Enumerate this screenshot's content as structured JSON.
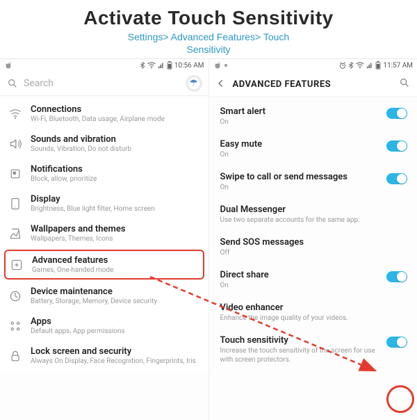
{
  "title": "Activate Touch Sensitivity",
  "breadcrumb_line1": "Settings> Advanced Features> Touch",
  "breadcrumb_line2": "Sensitivity",
  "left": {
    "status_time": "10:56 AM",
    "search_placeholder": "Search",
    "items": [
      {
        "icon": "connections",
        "label": "Connections",
        "sub": "Wi-Fi, Bluetooth, Data usage, Airplane mode"
      },
      {
        "icon": "sound",
        "label": "Sounds and vibration",
        "sub": "Sounds, Vibration, Do not disturb"
      },
      {
        "icon": "notifications",
        "label": "Notifications",
        "sub": "Block, allow, prioritize"
      },
      {
        "icon": "display",
        "label": "Display",
        "sub": "Brightness, Blue light filter, Home screen"
      },
      {
        "icon": "wallpapers",
        "label": "Wallpapers and themes",
        "sub": "Wallpapers, Themes, Icons"
      },
      {
        "icon": "advanced",
        "label": "Advanced features",
        "sub": "Games, One-handed mode",
        "highlight": true
      },
      {
        "icon": "maintenance",
        "label": "Device maintenance",
        "sub": "Battery, Storage, Memory, Device security"
      },
      {
        "icon": "apps",
        "label": "Apps",
        "sub": "Default apps, App permissions"
      },
      {
        "icon": "lock",
        "label": "Lock screen and security",
        "sub": "Always On Display, Face Recognition, Fingerprints, Iris"
      }
    ]
  },
  "right": {
    "status_time": "11:57 AM",
    "title": "ADVANCED FEATURES",
    "items": [
      {
        "label": "Smart alert",
        "sub": "On",
        "toggle": "on"
      },
      {
        "label": "Easy mute",
        "sub": "On",
        "toggle": "on"
      },
      {
        "label": "Swipe to call or send messages",
        "sub": "On",
        "toggle": "on"
      },
      {
        "label": "Dual Messenger",
        "sub": "Use two separate accounts for the same app."
      },
      {
        "label": "Send SOS messages",
        "sub": "Off"
      },
      {
        "label": "Direct share",
        "sub": "On",
        "toggle": "on"
      },
      {
        "label": "Video enhancer",
        "sub": "Enhance the image quality of your videos."
      },
      {
        "label": "Touch sensitivity",
        "sub": "Increase the touch sensitivity of the screen for use with screen protectors.",
        "toggle": "on",
        "callout": true
      }
    ]
  }
}
